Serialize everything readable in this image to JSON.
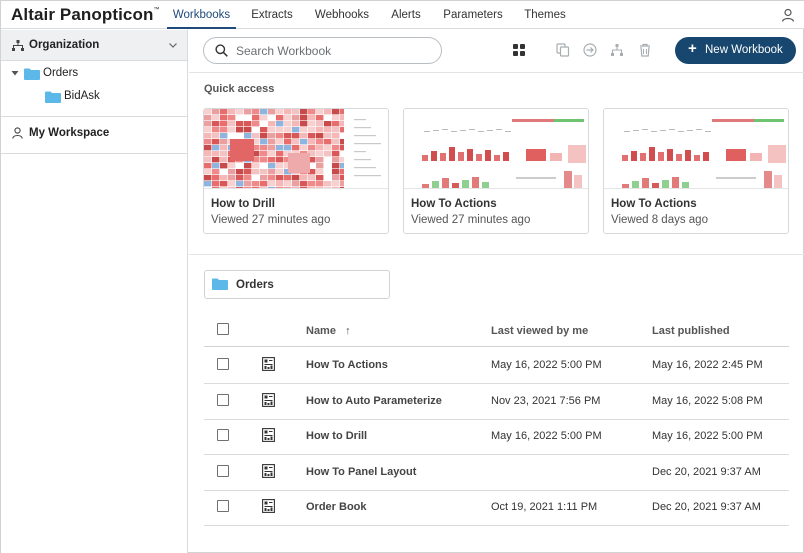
{
  "app": {
    "logo": "Altair Panopticon",
    "logo_mark": "™"
  },
  "nav": {
    "tabs": [
      "Workbooks",
      "Extracts",
      "Webhooks",
      "Alerts",
      "Parameters",
      "Themes"
    ],
    "active": "Workbooks",
    "user_icon": "user-icon"
  },
  "sidebar": {
    "header": "Organization",
    "tree": [
      {
        "label": "Orders",
        "expanded": true
      },
      {
        "label": "BidAsk"
      }
    ],
    "workspace": "My Workspace"
  },
  "toolbar": {
    "search_placeholder": "Search Workbook",
    "new_workbook_label": "New Workbook",
    "icons": [
      "grid-view-icon",
      "copy-icon",
      "move-icon",
      "hierarchy-icon",
      "trash-icon"
    ]
  },
  "quick_access": {
    "title": "Quick access",
    "cards": [
      {
        "title": "How to Drill",
        "viewed": "Viewed 27 minutes ago",
        "thumb": "treemap"
      },
      {
        "title": "How To Actions",
        "viewed": "Viewed 27 minutes ago",
        "thumb": "bars"
      },
      {
        "title": "How To Actions",
        "viewed": "Viewed 8 days ago",
        "thumb": "bars"
      }
    ]
  },
  "folder": {
    "label": "Orders"
  },
  "table": {
    "columns": {
      "name": "Name",
      "sort_indicator": "↑",
      "last_viewed": "Last viewed by me",
      "last_published": "Last published"
    },
    "rows": [
      {
        "name": "How To Actions",
        "last_viewed": "May 16, 2022 5:00 PM",
        "last_published": "May 16, 2022 2:45 PM"
      },
      {
        "name": "How to Auto Parameterize",
        "last_viewed": "Nov 23, 2021 7:56 PM",
        "last_published": "May 16, 2022 5:08 PM"
      },
      {
        "name": "How to Drill",
        "last_viewed": "May 16, 2022 5:00 PM",
        "last_published": "May 16, 2022 5:00 PM"
      },
      {
        "name": "How To Panel Layout",
        "last_viewed": "",
        "last_published": "Dec 20, 2021 9:37 AM"
      },
      {
        "name": "Order Book",
        "last_viewed": "Oct 19, 2021 1:11 PM",
        "last_published": "Dec 20, 2021 9:37 AM"
      }
    ]
  },
  "colors": {
    "accent": "#17466e",
    "active_tab": "#1f4a7a",
    "folder": "#5bb8e8"
  }
}
